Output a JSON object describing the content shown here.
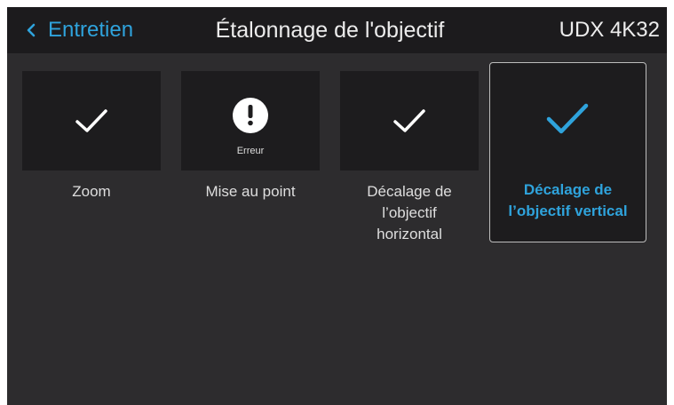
{
  "header": {
    "back_label": "Entretien",
    "title": "Étalonnage de l'objectif",
    "device": "UDX 4K32"
  },
  "tiles": [
    {
      "label": "Zoom",
      "status": "ok",
      "icon": "check-icon"
    },
    {
      "label": "Mise au point",
      "status": "error",
      "status_label": "Erreur",
      "icon": "exclamation-icon"
    },
    {
      "label": "Décalage de\nl’objectif\nhorizontal",
      "status": "ok",
      "icon": "check-icon"
    },
    {
      "label": "Décalage de\nl’objectif vertical",
      "status": "ok",
      "icon": "check-icon",
      "selected": true
    }
  ],
  "colors": {
    "accent": "#2fa3dc",
    "background": "#2d2c2e",
    "header_bg": "#1c1b1d",
    "tile_bg": "#1d1c1e",
    "text": "#ececec"
  }
}
